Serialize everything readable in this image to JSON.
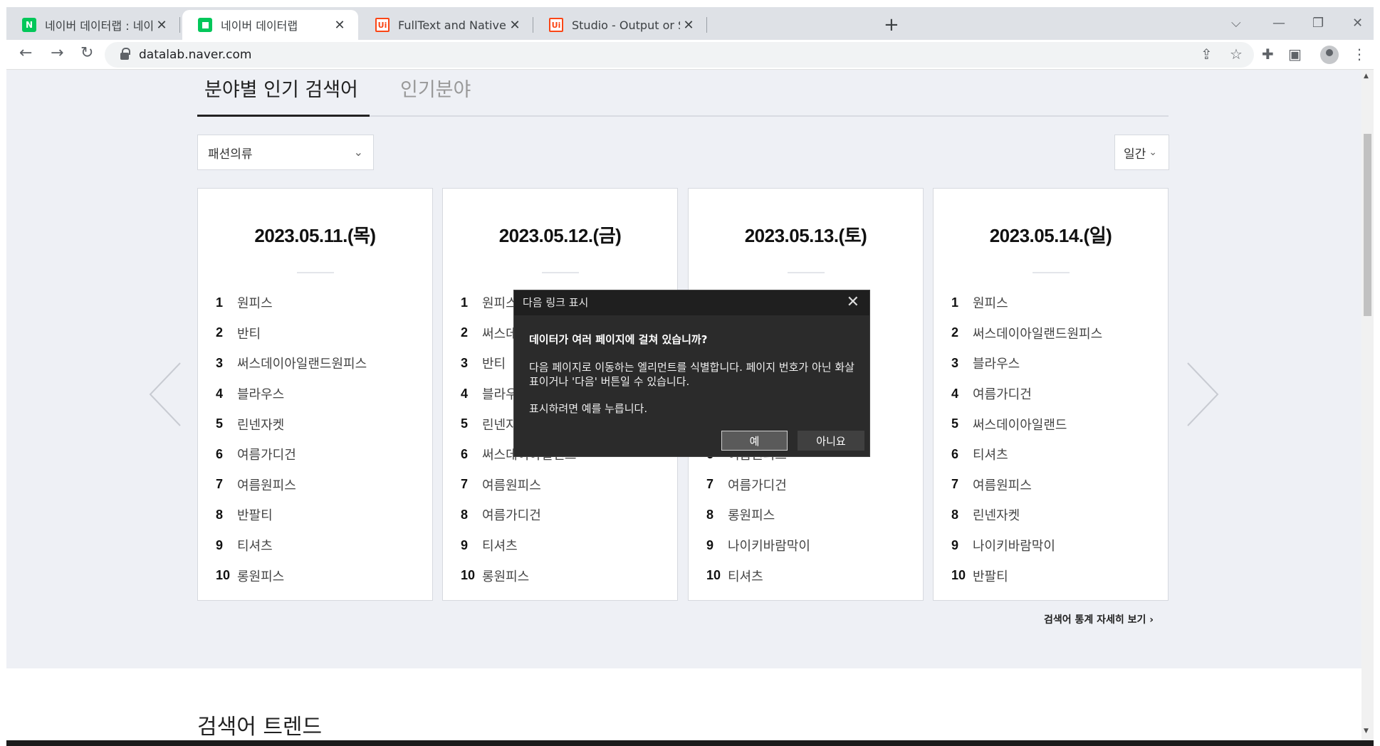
{
  "browser": {
    "tabs": [
      {
        "title": "네이버 데이터랩 : 네이버 통합검",
        "favicon": "naver-icon"
      },
      {
        "title": "네이버 데이터랩",
        "favicon": "datalab-icon"
      },
      {
        "title": "FullText and Native - Help - UiP",
        "favicon": "uipath-icon"
      },
      {
        "title": "Studio - Output or Screen Scrap",
        "favicon": "uipath-icon"
      }
    ],
    "url": "datalab.naver.com"
  },
  "section_tabs": {
    "active": "분야별 인기 검색어",
    "inactive": "인기분야"
  },
  "filters": {
    "category": "패션의류",
    "period": "일간"
  },
  "cards": [
    {
      "date": "2023.05.11.(목)",
      "keywords": [
        "원피스",
        "반티",
        "써스데이아일랜드원피스",
        "블라우스",
        "린넨자켓",
        "여름가디건",
        "여름원피스",
        "반팔티",
        "티셔츠",
        "롱원피스"
      ]
    },
    {
      "date": "2023.05.12.(금)",
      "keywords": [
        "원피스",
        "써스데이아일랜드",
        "반티",
        "블라우스",
        "린넨자켓",
        "써스데이아일랜드",
        "여름원피스",
        "여름가디건",
        "티셔츠",
        "롱원피스"
      ]
    },
    {
      "date": "2023.05.13.(토)",
      "keywords": [
        "",
        "",
        "",
        "",
        "",
        "여름원피스",
        "여름가디건",
        "롱원피스",
        "나이키바람막이",
        "티셔츠"
      ]
    },
    {
      "date": "2023.05.14.(일)",
      "keywords": [
        "원피스",
        "써스데이아일랜드원피스",
        "블라우스",
        "여름가디건",
        "써스데이아일랜드",
        "티셔츠",
        "여름원피스",
        "린넨자켓",
        "나이키바람막이",
        "반팔티"
      ]
    }
  ],
  "ranks": [
    "1",
    "2",
    "3",
    "4",
    "5",
    "6",
    "7",
    "8",
    "9",
    "10"
  ],
  "more_link": "검색어 통계 자세히 보기",
  "trend_title": "검색어 트렌드",
  "dialog": {
    "title": "다음 링크 표시",
    "heading": "데이터가 여러 페이지에 걸쳐 있습니까?",
    "body1": "다음 페이지로 이동하는 엘리먼트를 식별합니다. 페이지 번호가 아닌 화살표이거나 '다음' 버튼일 수 있습니다.",
    "body2": "표시하려면 예를 누릅니다.",
    "yes": "예",
    "no": "아니요"
  }
}
